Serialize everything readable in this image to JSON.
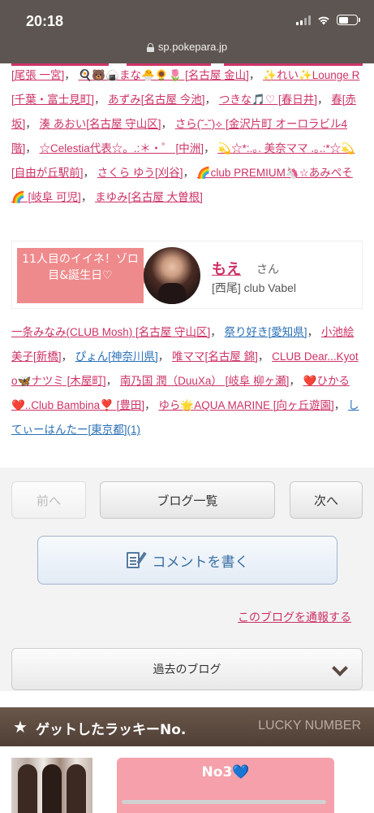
{
  "status_bar": {
    "time": "20:18"
  },
  "browser": {
    "url": "sp.pokepara.jp"
  },
  "links_top": [
    {
      "text": "[尾張 一宮]",
      "color": "pink"
    },
    {
      "text": "🍳🐻🍙まな🐣🌻🌷 [名古屋 金山]",
      "color": "pink"
    },
    {
      "text": "✨れい✨Lounge R [千葉・富士見町]",
      "color": "pink"
    },
    {
      "text": "あずみ[名古屋 今池]",
      "color": "pink"
    },
    {
      "text": "つきな🎵♡ [春日井]",
      "color": "pink"
    },
    {
      "text": "春[赤坂]",
      "color": "pink"
    },
    {
      "text": "湊 あおい[名古屋 守山区]",
      "color": "pink"
    },
    {
      "text": "さら(˘-˘)⟡ [金沢片町 オーロラビル4階]",
      "color": "pink"
    },
    {
      "text": "☆Celestia代表☆。.:＊・゜ [中洲]",
      "color": "pink"
    },
    {
      "text": "💫☆*:.｡. 美奈ママ .｡.:*☆💫 [自由が丘駅前]",
      "color": "pink"
    },
    {
      "text": "さくら ゆう[刈谷]",
      "color": "pink"
    },
    {
      "text": "🌈club PREMIUM🦄☆あみぺそ🌈 [岐阜 可児]",
      "color": "pink"
    },
    {
      "text": "まゆみ[名古屋 大曽根]",
      "color": "pink"
    }
  ],
  "highlight": {
    "badge": "11人目のイイネ！ゾロ目&誕生日♡",
    "name": "もえ",
    "suffix": "さん",
    "shop": "[西尾] club Vabel"
  },
  "links_mid": [
    {
      "text": "一条みなみ(CLUB Mosh) [名古屋 守山区]",
      "color": "pink"
    },
    {
      "text": "祭り好き[愛知県]",
      "color": "blue"
    },
    {
      "text": "小池絵美子[新橋]",
      "color": "pink"
    },
    {
      "text": "ぴょん[神奈川県]",
      "color": "blue"
    },
    {
      "text": "唯ママ[名古屋 錦]",
      "color": "pink"
    },
    {
      "text": "CLUB Dear...Kyoto🦋ナツミ [木屋町]",
      "color": "pink"
    },
    {
      "text": "南乃国 潤（DuuXa） [岐阜 柳ヶ瀬]",
      "color": "pink"
    },
    {
      "text": "❤️ひかる❤️..Club Bambina❣️ [豊田]",
      "color": "pink"
    },
    {
      "text": "ゆら🌟AQUA MARINE [向ヶ丘遊園]",
      "color": "pink"
    },
    {
      "text": "してぃーはんたー[東京都](1)",
      "color": "blue"
    }
  ],
  "nav": {
    "prev": "前へ",
    "list": "ブログ一覧",
    "next": "次へ"
  },
  "comment_button": "コメントを書く",
  "report_link": "このブログを通報する",
  "past_blog": "過去のブログ",
  "lucky": {
    "title": "ゲットしたラッキーNo.",
    "title_en": "LUCKY NUMBER",
    "number": "No3💙"
  }
}
